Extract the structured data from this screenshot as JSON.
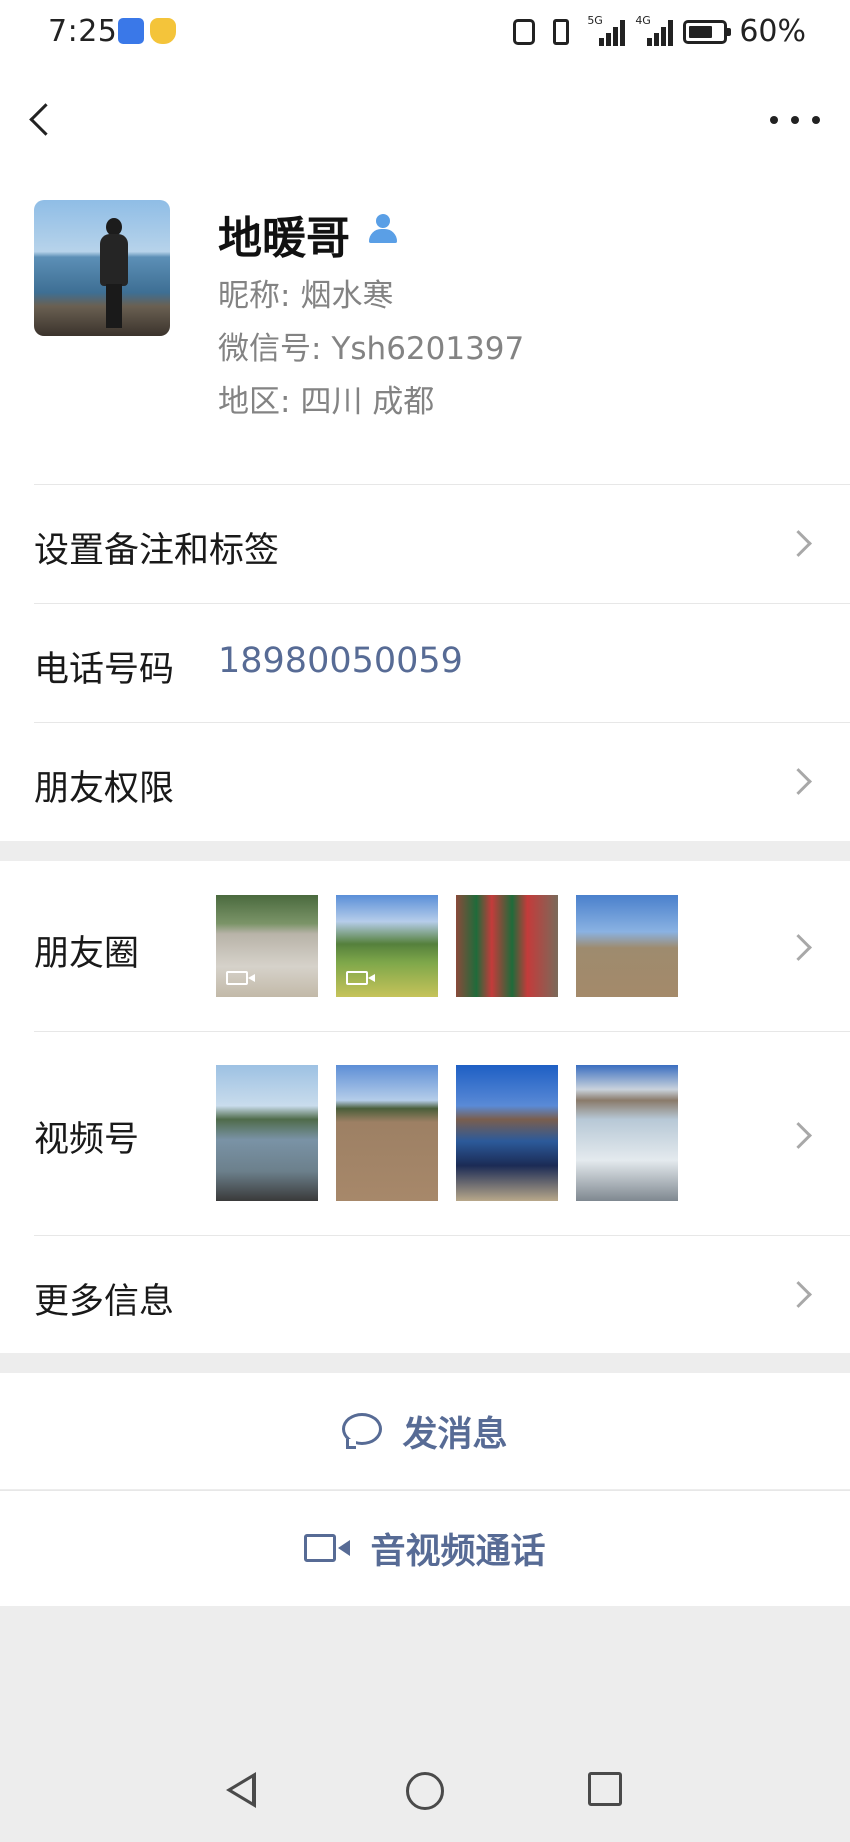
{
  "status_bar": {
    "time": "7:25",
    "signal_5g": "5G",
    "signal_4g": "4G",
    "battery": "60%"
  },
  "profile": {
    "name": "地暖哥",
    "nickname_label": "昵称:",
    "nickname": "烟水寒",
    "wechat_id_label": "微信号:",
    "wechat_id": "Ysh6201397",
    "region_label": "地区:",
    "region": "四川  成都"
  },
  "rows": {
    "remark": "设置备注和标签",
    "phone_label": "电话号码",
    "phone": "18980050059",
    "friend_permissions": "朋友权限",
    "moments": "朋友圈",
    "channels": "视频号",
    "more_info": "更多信息"
  },
  "actions": {
    "send_message": "发消息",
    "video_call": "音视频通话"
  },
  "icons": {
    "back": "back-arrow-icon",
    "more": "more-dots-icon",
    "contact_badge": "contact-person-icon",
    "chevron": "chevron-right-icon",
    "chat": "chat-bubble-icon",
    "video": "video-camera-icon"
  },
  "colors": {
    "link_blue": "#576b95",
    "badge_blue": "#5a9fe6",
    "background": "#ededed"
  }
}
